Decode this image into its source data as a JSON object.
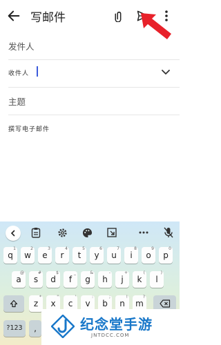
{
  "header": {
    "title": "写邮件"
  },
  "form": {
    "from_label": "发件人",
    "to_label": "收件人",
    "subject_label": "主题",
    "body_placeholder": "撰写电子邮件"
  },
  "keyboard": {
    "row1": [
      {
        "k": "q",
        "s": "1"
      },
      {
        "k": "w",
        "s": "2"
      },
      {
        "k": "e",
        "s": "3"
      },
      {
        "k": "r",
        "s": "4"
      },
      {
        "k": "t",
        "s": "5"
      },
      {
        "k": "y",
        "s": "6"
      },
      {
        "k": "u",
        "s": "7"
      },
      {
        "k": "i",
        "s": "8"
      },
      {
        "k": "o",
        "s": "9"
      },
      {
        "k": "p",
        "s": "0"
      }
    ],
    "row2": [
      {
        "k": "a",
        "s": "@"
      },
      {
        "k": "s",
        "s": "#"
      },
      {
        "k": "d",
        "s": "$"
      },
      {
        "k": "f",
        "s": "_"
      },
      {
        "k": "g",
        "s": "&"
      },
      {
        "k": "h",
        "s": "-"
      },
      {
        "k": "j",
        "s": "+"
      },
      {
        "k": "k",
        "s": "("
      },
      {
        "k": "l",
        "s": ")"
      }
    ],
    "row3": [
      {
        "k": "z",
        "s": "*"
      },
      {
        "k": "x",
        "s": "\""
      },
      {
        "k": "c",
        "s": "'"
      },
      {
        "k": "v",
        "s": ":"
      },
      {
        "k": "b",
        "s": ";"
      },
      {
        "k": "n",
        "s": "!"
      },
      {
        "k": "m",
        "s": "?"
      }
    ],
    "symbols_label": "?123",
    "comma_label": ","
  },
  "watermark": {
    "name": "纪念堂手游",
    "url": "JNTDCC.COM"
  },
  "colors": {
    "accent_blue": "#1877c9",
    "arrow_red": "#e8212a",
    "cursor": "#3b5bdb"
  }
}
